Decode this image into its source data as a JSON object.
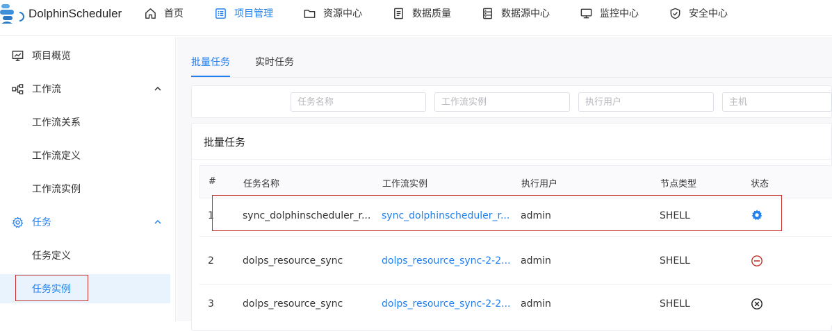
{
  "app": {
    "name": "DolphinScheduler"
  },
  "nav": [
    {
      "label": "首页",
      "icon": "home-icon"
    },
    {
      "label": "项目管理",
      "icon": "project-icon",
      "active": true
    },
    {
      "label": "资源中心",
      "icon": "folder-icon"
    },
    {
      "label": "数据质量",
      "icon": "document-icon"
    },
    {
      "label": "数据源中心",
      "icon": "database-icon"
    },
    {
      "label": "监控中心",
      "icon": "monitor-icon"
    },
    {
      "label": "安全中心",
      "icon": "shield-icon"
    }
  ],
  "sidebar": {
    "items": [
      {
        "label": "项目概览",
        "icon": "overview-icon"
      },
      {
        "label": "工作流",
        "icon": "workflow-icon"
      },
      {
        "label": "工作流关系"
      },
      {
        "label": "工作流定义"
      },
      {
        "label": "工作流实例"
      },
      {
        "label": "任务",
        "icon": "gear-icon"
      },
      {
        "label": "任务定义"
      },
      {
        "label": "任务实例"
      }
    ]
  },
  "tabs": [
    {
      "label": "批量任务",
      "active": true
    },
    {
      "label": "实时任务"
    }
  ],
  "filters": {
    "task_name_placeholder": "任务名称",
    "workflow_instance_placeholder": "工作流实例",
    "executor_placeholder": "执行用户",
    "host_placeholder": "主机"
  },
  "list": {
    "title": "批量任务",
    "columns": [
      "#",
      "任务名称",
      "工作流实例",
      "执行用户",
      "节点类型",
      "状态"
    ],
    "rows": [
      {
        "index": "1",
        "task_name": "sync_dolphinscheduler_r...",
        "workflow_instance": "sync_dolphinscheduler_r...",
        "user": "admin",
        "type": "SHELL",
        "state": "running"
      },
      {
        "index": "2",
        "task_name": "dolps_resource_sync",
        "workflow_instance": "dolps_resource_sync-2-2...",
        "user": "admin",
        "type": "SHELL",
        "state": "stopped"
      },
      {
        "index": "3",
        "task_name": "dolps_resource_sync",
        "workflow_instance": "dolps_resource_sync-2-2...",
        "user": "admin",
        "type": "SHELL",
        "state": "failed"
      }
    ]
  },
  "colors": {
    "accent": "#2080f0",
    "highlight_box": "#c4302b",
    "stop_red": "#c0392b"
  }
}
